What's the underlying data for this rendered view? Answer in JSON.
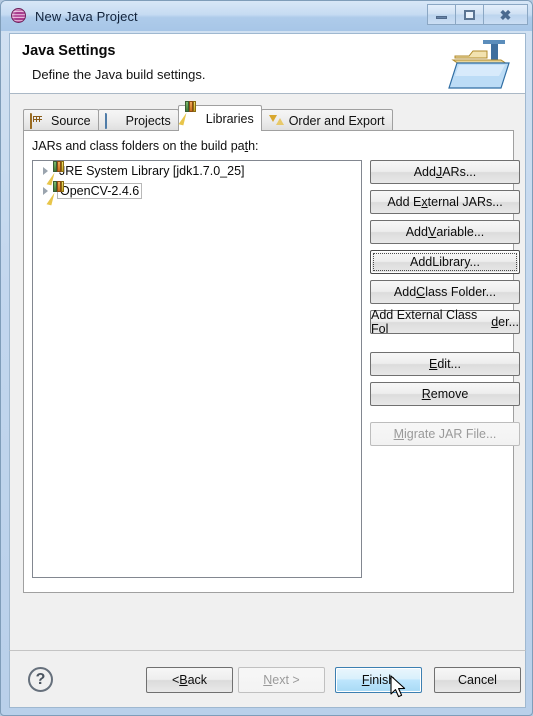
{
  "window": {
    "title": "New Java Project",
    "title_icon": "java-sphere-icon",
    "controls": {
      "minimize": "minimize-icon",
      "maximize": "maximize-icon",
      "close": "close-icon"
    }
  },
  "header": {
    "title": "Java Settings",
    "subtitle": "Define the Java build settings.",
    "icon": "java-folder-icon"
  },
  "tabs": [
    {
      "label": "Source",
      "icon": "package-folder-icon",
      "active": false
    },
    {
      "label": "Projects",
      "icon": "open-folder-icon",
      "active": false
    },
    {
      "label": "Libraries",
      "icon": "books-icon",
      "active": true
    },
    {
      "label": "Order and Export",
      "icon": "order-arrows-icon",
      "active": false
    }
  ],
  "libraries_tab": {
    "tree_label_pre": "JARs and class folders on the build pa",
    "tree_label_mnemonic": "t",
    "tree_label_post": "h:",
    "tree_items": [
      {
        "label": "JRE System Library [jdk1.7.0_25]",
        "icon": "library-books-icon",
        "selected": false,
        "expandable": true
      },
      {
        "label": "OpenCV-2.4.6",
        "icon": "library-books-icon",
        "selected": true,
        "expandable": true
      }
    ],
    "buttons": [
      {
        "pre": "Add ",
        "mnemonic": "J",
        "post": "ARs...",
        "state": "normal",
        "group": 1
      },
      {
        "pre": "Add E",
        "mnemonic": "x",
        "post": "ternal JARs...",
        "state": "normal",
        "group": 1
      },
      {
        "pre": "Add ",
        "mnemonic": "V",
        "post": "ariable...",
        "state": "normal",
        "group": 1
      },
      {
        "pre": "Add ",
        "mnemonic": "L",
        "post": "ibrary...",
        "state": "focused",
        "group": 1
      },
      {
        "pre": "Add ",
        "mnemonic": "C",
        "post": "lass Folder...",
        "state": "normal",
        "group": 1
      },
      {
        "pre": "Add External Class Fol",
        "mnemonic": "d",
        "post": "er...",
        "state": "normal",
        "group": 1
      },
      {
        "pre": "",
        "mnemonic": "E",
        "post": "dit...",
        "state": "normal",
        "group": 2
      },
      {
        "pre": "",
        "mnemonic": "R",
        "post": "emove",
        "state": "normal",
        "group": 2
      },
      {
        "pre": "",
        "mnemonic": "M",
        "post": "igrate JAR File...",
        "state": "disabled",
        "group": 3
      }
    ]
  },
  "footer": {
    "help_label": "?",
    "buttons": [
      {
        "pre": "< ",
        "mnemonic": "B",
        "post": "ack",
        "id": "back",
        "state": "normal"
      },
      {
        "pre": "",
        "mnemonic": "N",
        "post": "ext >",
        "id": "next",
        "state": "disabled"
      },
      {
        "pre": "",
        "mnemonic": "F",
        "post": "inish",
        "id": "finish",
        "state": "hover"
      },
      {
        "pre": "",
        "mnemonic": "",
        "post": "Cancel",
        "id": "cancel",
        "state": "normal"
      }
    ]
  },
  "colors": {
    "titlebar": "#a7c6e7",
    "dialog_bg": "#f0f0f0",
    "panel_bg": "#ffffff",
    "accent_hover": "#3c7fb1",
    "border": "#9fb8d0"
  }
}
